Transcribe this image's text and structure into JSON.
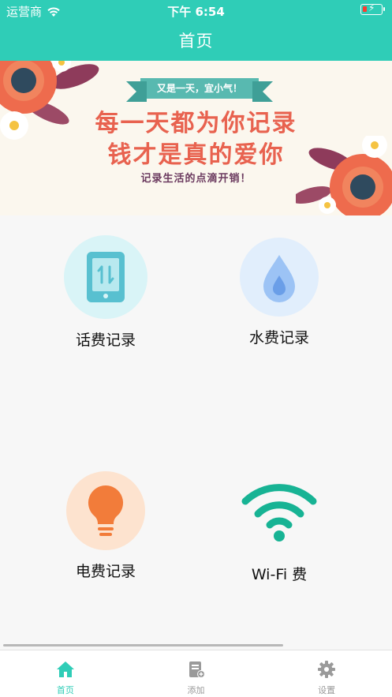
{
  "status_bar": {
    "carrier": "运营商",
    "time": "下午 6:54"
  },
  "nav": {
    "title": "首页"
  },
  "banner": {
    "ribbon": "又是一天，宜小气！",
    "line1": "每一天都为你记录",
    "line2": "钱才是真的爱你",
    "line3": "记录生活的点滴开销！"
  },
  "tiles": [
    {
      "label": "话费记录",
      "icon": "phone-icon",
      "color": "#d9f4f7"
    },
    {
      "label": "水费记录",
      "icon": "water-drop-icon",
      "color": "#e1eefc"
    },
    {
      "label": "电费记录",
      "icon": "lightbulb-icon",
      "color": "#fde3cf"
    },
    {
      "label": "Wi-Fi 费",
      "icon": "wifi-icon",
      "color": "none"
    }
  ],
  "tabbar": {
    "items": [
      {
        "label": "首页",
        "icon": "home-icon",
        "active": true
      },
      {
        "label": "添加",
        "icon": "add-document-icon",
        "active": false
      },
      {
        "label": "设置",
        "icon": "gear-icon",
        "active": false
      }
    ]
  },
  "colors": {
    "accent": "#2fcdb7",
    "tab_inactive": "#999999"
  }
}
